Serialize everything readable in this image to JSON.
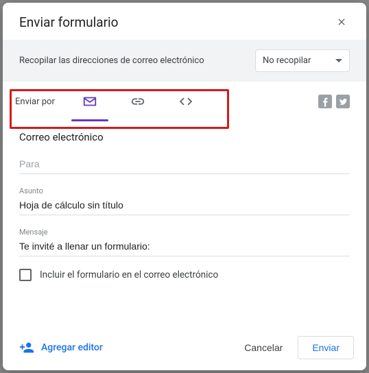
{
  "header": {
    "title": "Enviar formulario"
  },
  "collect": {
    "label": "Recopilar las direcciones de correo electrónico",
    "selected": "No recopilar"
  },
  "sendVia": {
    "label": "Enviar por"
  },
  "email": {
    "section_title": "Correo electrónico",
    "to_placeholder": "Para",
    "subject_label": "Asunto",
    "subject_value": "Hoja de cálculo sin título",
    "message_label": "Mensaje",
    "message_value": "Te invité a llenar un formulario:",
    "include_label": "Incluir el formulario en el correo electrónico"
  },
  "footer": {
    "add_editor": "Agregar editor",
    "cancel": "Cancelar",
    "send": "Enviar"
  }
}
